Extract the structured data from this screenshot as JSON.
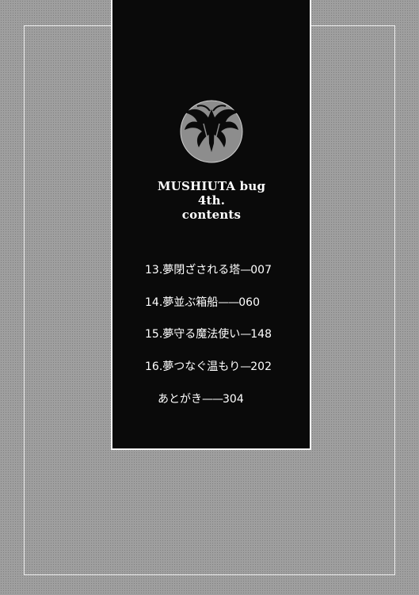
{
  "title": {
    "line1": "MUSHIUTA bug",
    "line2": "4th.",
    "line3": "contents"
  },
  "emblem": {
    "icon": "moth-emblem-icon"
  },
  "toc": [
    {
      "label": "13.夢閉ざされる塔",
      "dash": "—",
      "page": "007"
    },
    {
      "label": "14.夢並ぶ箱船",
      "dash": "——",
      "page": "060"
    },
    {
      "label": "15.夢守る魔法使い",
      "dash": "—",
      "page": "148"
    },
    {
      "label": "16.夢つなぐ温もり",
      "dash": "—",
      "page": "202"
    },
    {
      "label": "あとがき",
      "dash": "——",
      "page": "304"
    }
  ],
  "colors": {
    "panel": "#0a0a0a",
    "page": "#9f9f9f",
    "text": "#ffffff"
  }
}
